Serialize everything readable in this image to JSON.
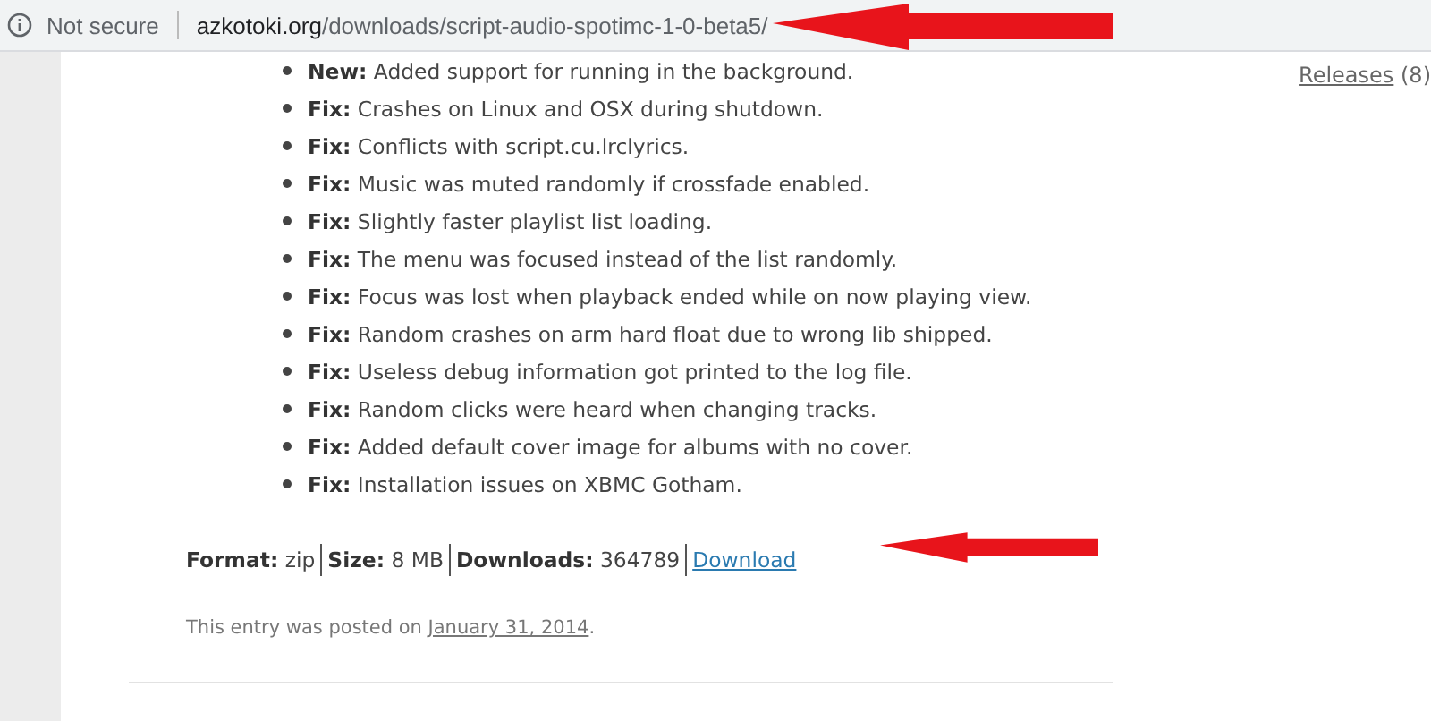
{
  "address_bar": {
    "security": "Not secure",
    "url_host": "azkotoki.org",
    "url_path": "/downloads/script-audio-spotimc-1-0-beta5/"
  },
  "changelog": [
    {
      "tag": "New:",
      "text": "Added support for running in the background."
    },
    {
      "tag": "Fix:",
      "text": "Crashes on Linux and OSX during shutdown."
    },
    {
      "tag": "Fix:",
      "text": "Conflicts with script.cu.lrclyrics."
    },
    {
      "tag": "Fix:",
      "text": "Music was muted randomly if crossfade enabled."
    },
    {
      "tag": "Fix:",
      "text": "Slightly faster playlist list loading."
    },
    {
      "tag": "Fix:",
      "text": "The menu was focused instead of the list randomly."
    },
    {
      "tag": "Fix:",
      "text": "Focus was lost when playback ended while on now playing view."
    },
    {
      "tag": "Fix:",
      "text": "Random crashes on arm hard float due to wrong lib shipped."
    },
    {
      "tag": "Fix:",
      "text": "Useless debug information got printed to the log file."
    },
    {
      "tag": "Fix:",
      "text": "Random clicks were heard when changing tracks."
    },
    {
      "tag": "Fix:",
      "text": "Added default cover image for albums with no cover."
    },
    {
      "tag": "Fix:",
      "text": "Installation issues on XBMC Gotham."
    }
  ],
  "meta": [
    {
      "label": "Format:",
      "value": "zip"
    },
    {
      "label": "Size:",
      "value": "8 MB"
    },
    {
      "label": "Downloads:",
      "value": "364789"
    }
  ],
  "download_link": "Download",
  "posted": {
    "text": "This entry was posted on ",
    "date": "January 31, 2014",
    "end": "."
  },
  "sidebar": {
    "link": "Releases",
    "count": "(8)"
  },
  "annotations": [
    {
      "kind": "arrow"
    },
    {
      "kind": "arrow"
    }
  ]
}
